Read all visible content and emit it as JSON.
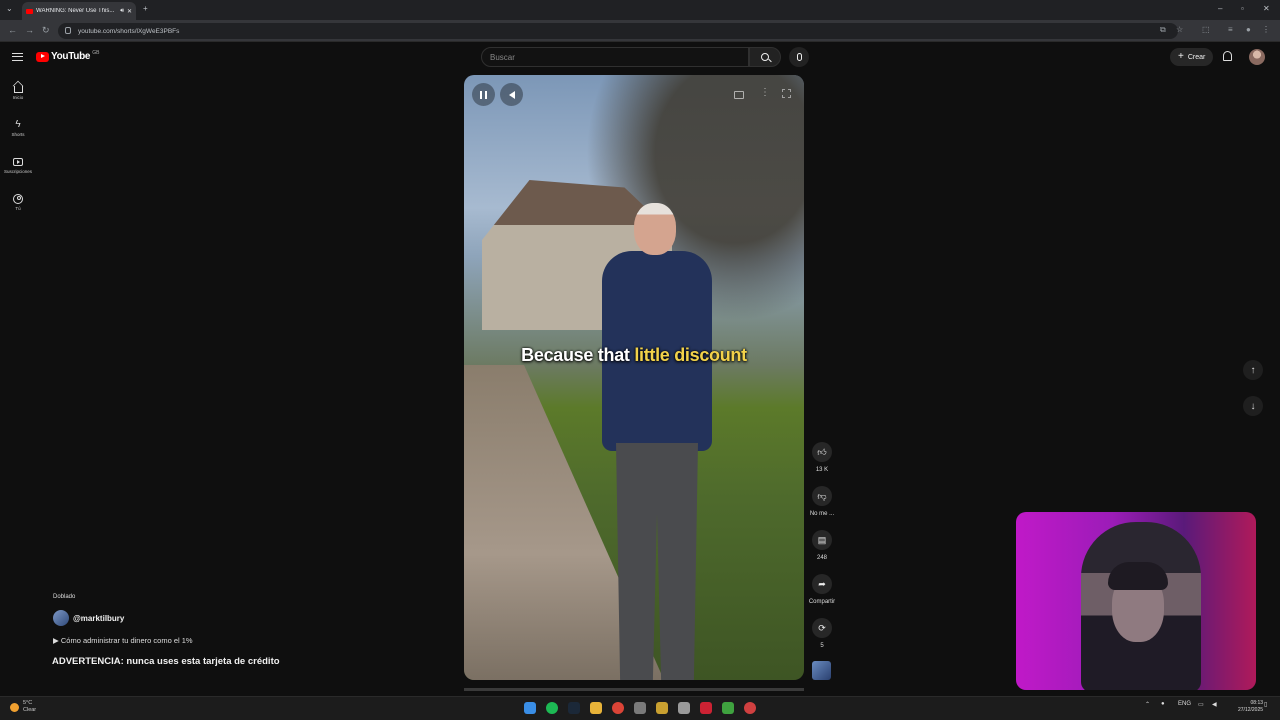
{
  "browser": {
    "tab_title": "WARNING: Never Use This...",
    "url": "youtube.com/shorts/lXgWeE3PBFs"
  },
  "header": {
    "logo_text": "YouTube",
    "country_code": "GB",
    "search_placeholder": "Buscar",
    "create_label": "Crear"
  },
  "sidebar": {
    "items": [
      {
        "label": "Inicio",
        "icon": "home-icon"
      },
      {
        "label": "Shorts",
        "icon": "shorts-icon"
      },
      {
        "label": "Suscripciones",
        "icon": "subscriptions-icon"
      },
      {
        "label": "Tú",
        "icon": "you-icon"
      }
    ]
  },
  "video": {
    "caption_prefix": "Because that",
    "caption_highlight": "little discount",
    "caption_highlight_color": "#f2d24a"
  },
  "actions": {
    "like_count": "13 K",
    "dislike_label": "No me ...",
    "comments_count": "248",
    "share_label": "Compartir",
    "remix_count": "5"
  },
  "info": {
    "dubbed_label": "Doblado",
    "channel": "@marktilbury",
    "playlist_link": "Cómo administrar tu dinero como el 1%",
    "title": "ADVERTENCIA: nunca uses esta tarjeta de crédito"
  },
  "taskbar": {
    "weather_temp": "5°C",
    "weather_desc": "Clear",
    "language": "ENG",
    "time": "08:13",
    "date": "27/12/2025"
  },
  "colors": {
    "accent": "#ff0000",
    "background": "#0f0f0f",
    "webcam_bg": "#c019c8"
  }
}
